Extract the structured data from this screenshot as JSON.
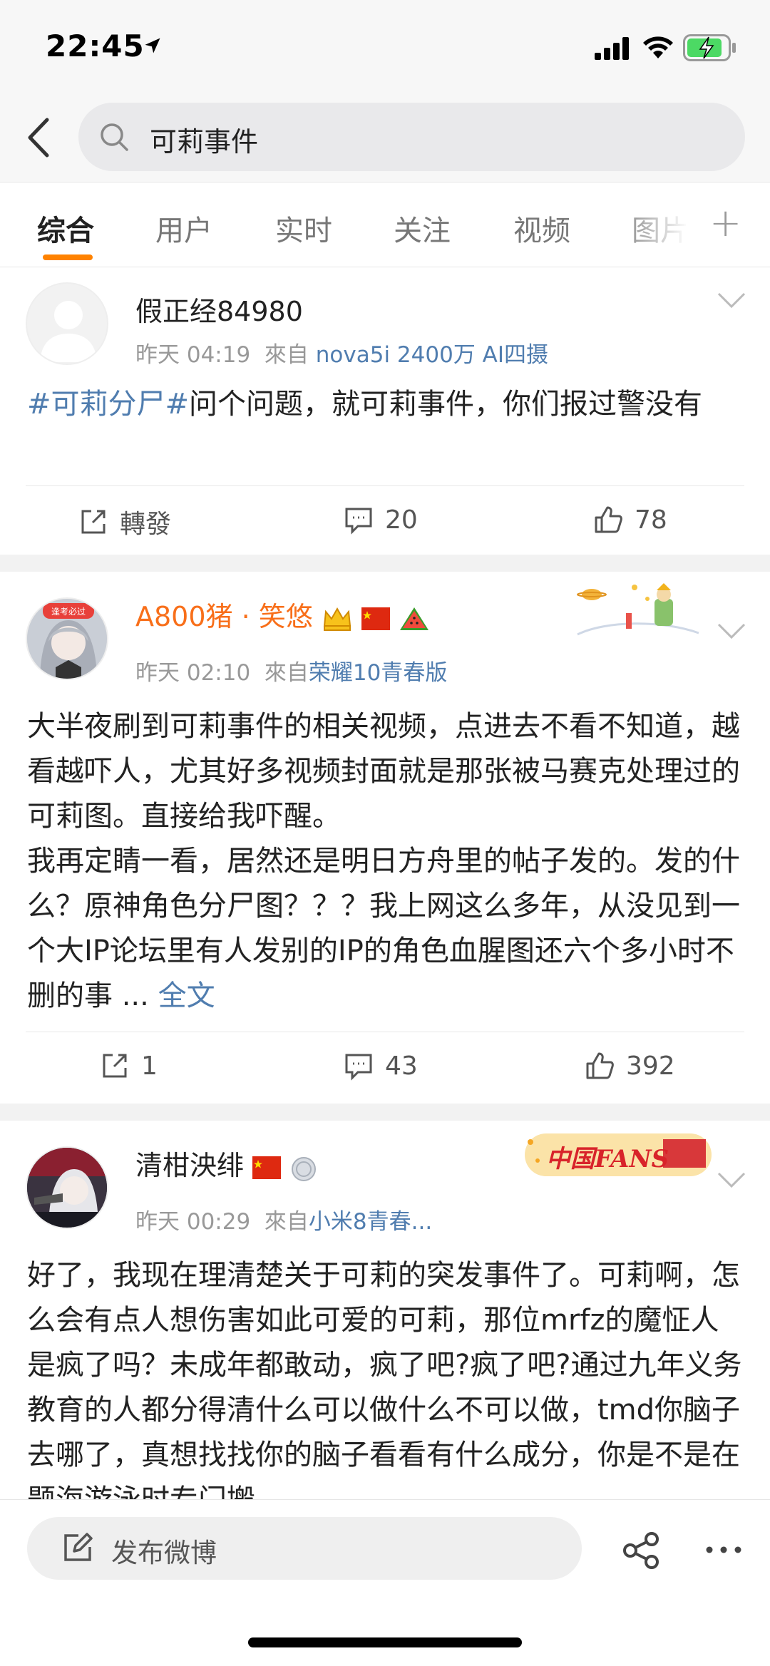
{
  "status_bar": {
    "time": "22:45"
  },
  "search": {
    "query": "可莉事件"
  },
  "tabs": [
    "综合",
    "用户",
    "实时",
    "关注",
    "视频",
    "图片"
  ],
  "posts": [
    {
      "username": "假正经84980",
      "time": "昨天 04:19",
      "source_prefix": "來自",
      "source": "nova5i 2400万 AI四摄",
      "text_tag": "#可莉分尸#",
      "text_rest": "问个问题，就可莉事件，你们报过警没有",
      "repost_label": "轉發",
      "comments": "20",
      "likes": "78"
    },
    {
      "username": "A800猪 · 笑悠",
      "time": "昨天 02:10",
      "source_prefix": "來自",
      "source": "荣耀10青春版",
      "text_p1": "大半夜刷到可莉事件的相关视频，点进去不看不知道，越看越吓人，尤其好多视频封面就是那张被马赛克处理过的可莉图。直接给我吓醒。",
      "text_p2": "我再定睛一看，居然还是明日方舟里的帖子发的。发的什么？原神角色分尸图？？？我上网这么多年，从没见到一个大IP论坛里有人发别的IP的角色血腥图还六个多小时不删的事 ...",
      "full_text_link": "全文",
      "reposts": "1",
      "comments": "43",
      "likes": "392"
    },
    {
      "username": "清柑泱绯",
      "time": "昨天 00:29",
      "source_prefix": "來自",
      "source": "小米8青春...",
      "text": "好了，我现在理清楚关于可莉的突发事件了。可莉啊，怎么会有点人想伤害如此可爱的可莉，那位mrfz的魔怔人是疯了吗？未成年都敢动，疯了吧?疯了吧?通过九年义务教育的人都分得清什么可以做什么不可以做，tmd你脑子去哪了，真想找找你的脑子看看有什么成分，你是不是在题海游泳时专门搬",
      "badge_text": "中国FANS"
    }
  ],
  "bottom_bar": {
    "compose_label": "发布微博"
  },
  "colors": {
    "accent": "#ff8200",
    "link": "#507daf",
    "vip_name": "#f86f1a"
  }
}
